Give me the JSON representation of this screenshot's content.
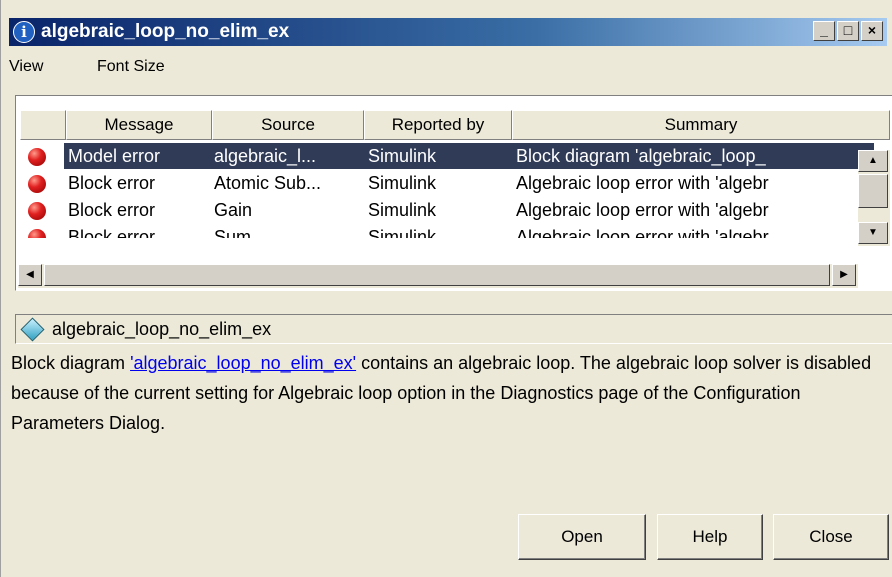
{
  "window": {
    "title": "algebraic_loop_no_elim_ex",
    "controls": {
      "minimize": "_",
      "maximize": "□",
      "close": "×"
    }
  },
  "menu": [
    "View",
    "Font Size"
  ],
  "table": {
    "columns": [
      "Message",
      "Source",
      "Reported by",
      "Summary"
    ],
    "rows": [
      {
        "message": "Model error",
        "source": "algebraic_l...",
        "reported_by": "Simulink",
        "summary": "Block diagram 'algebraic_loop_",
        "selected": true
      },
      {
        "message": "Block error",
        "source": "Atomic Sub...",
        "reported_by": "Simulink",
        "summary": "Algebraic loop error with 'algebr"
      },
      {
        "message": "Block error",
        "source": "Gain",
        "reported_by": "Simulink",
        "summary": "Algebraic loop error with 'algebr"
      },
      {
        "message": "Block error",
        "source": "Sum",
        "reported_by": "Simulink",
        "summary": "Algebraic loop error with 'algebr"
      }
    ]
  },
  "detail": {
    "title": "algebraic_loop_no_elim_ex",
    "message_before": "Block diagram ",
    "message_link": "'algebraic_loop_no_elim_ex'",
    "message_after": " contains an algebraic loop. The algebraic loop solver is disabled because of the current setting for Algebraic loop option in the Diagnostics page of the Configuration Parameters Dialog."
  },
  "buttons": {
    "open": "Open",
    "help": "Help",
    "close": "Close"
  },
  "colors": {
    "selection": "#303b58",
    "link": "#0000ee",
    "title_gradient_start": "#0a246a"
  }
}
